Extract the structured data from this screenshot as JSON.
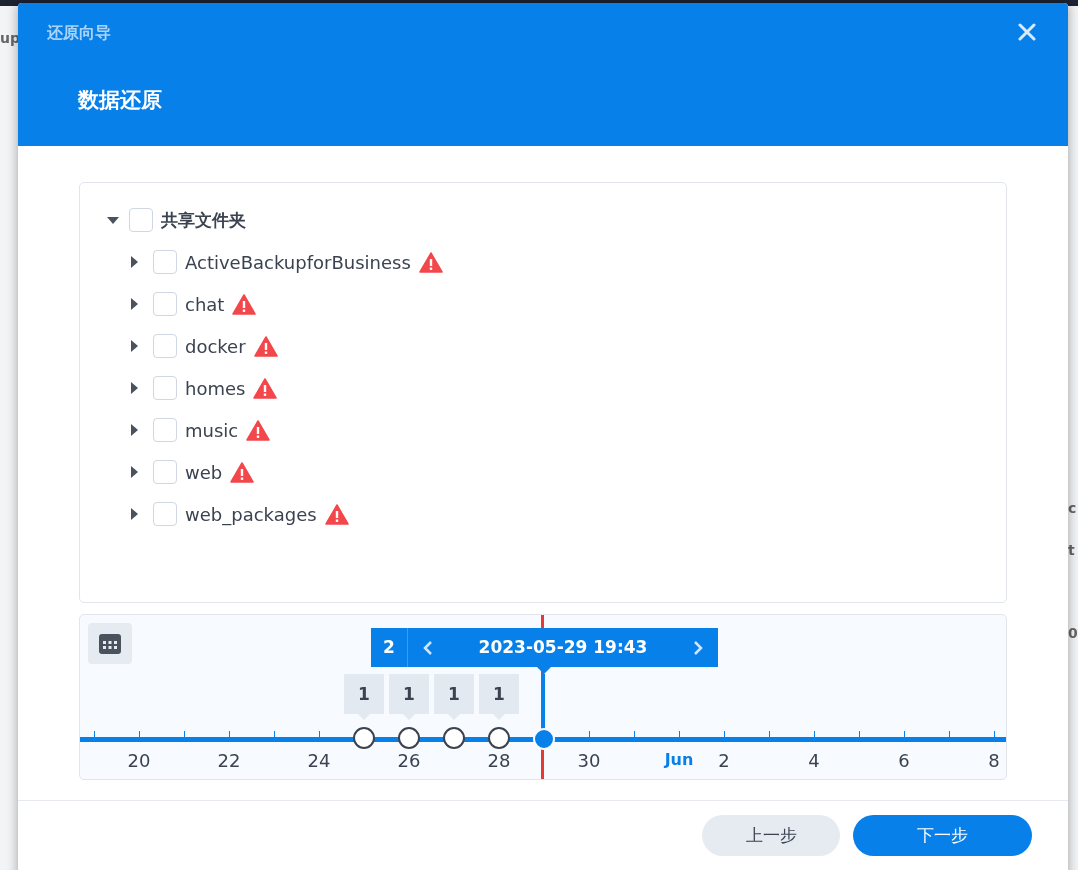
{
  "background": {
    "left_fragments": [
      "up"
    ],
    "right_fragments": [
      "c",
      "t",
      "0"
    ]
  },
  "dialog": {
    "title": "还原向导",
    "heading": "数据还原"
  },
  "tree": {
    "label": "共享文件夹",
    "expanded": true,
    "checked": false,
    "children": [
      {
        "label": "ActiveBackupforBusiness",
        "checked": false,
        "expanded": false,
        "warning": true
      },
      {
        "label": "chat",
        "checked": false,
        "expanded": false,
        "warning": true
      },
      {
        "label": "docker",
        "checked": false,
        "expanded": false,
        "warning": true
      },
      {
        "label": "homes",
        "checked": false,
        "expanded": false,
        "warning": true
      },
      {
        "label": "music",
        "checked": false,
        "expanded": false,
        "warning": true
      },
      {
        "label": "web",
        "checked": false,
        "expanded": false,
        "warning": true
      },
      {
        "label": "web_packages",
        "checked": false,
        "expanded": false,
        "warning": true
      }
    ]
  },
  "timeline": {
    "days": [
      {
        "kind": "tick"
      },
      {
        "kind": "day",
        "label": "20"
      },
      {
        "kind": "tick"
      },
      {
        "kind": "day",
        "label": "22"
      },
      {
        "kind": "tick"
      },
      {
        "kind": "day",
        "label": "24"
      },
      {
        "kind": "tick",
        "snapshot": {
          "selected": false,
          "count": "1"
        }
      },
      {
        "kind": "day",
        "label": "26",
        "snapshot": {
          "selected": false,
          "count": "1"
        }
      },
      {
        "kind": "tick",
        "snapshot": {
          "selected": false,
          "count": "1"
        }
      },
      {
        "kind": "day",
        "label": "28",
        "snapshot": {
          "selected": false,
          "count": "1"
        }
      },
      {
        "kind": "tick",
        "snapshot": {
          "selected": true,
          "count": "2",
          "time": "2023-05-29 19:43"
        }
      },
      {
        "kind": "day",
        "label": "30"
      },
      {
        "kind": "tick"
      },
      {
        "kind": "month",
        "label": "Jun"
      },
      {
        "kind": "day",
        "label": "2"
      },
      {
        "kind": "tick"
      },
      {
        "kind": "day",
        "label": "4"
      },
      {
        "kind": "tick"
      },
      {
        "kind": "day",
        "label": "6"
      },
      {
        "kind": "tick"
      },
      {
        "kind": "day",
        "label": "8"
      }
    ]
  },
  "buttons": [
    {
      "label": "上一步",
      "kind": "secondary"
    },
    {
      "label": "下一步",
      "kind": "primary"
    }
  ]
}
